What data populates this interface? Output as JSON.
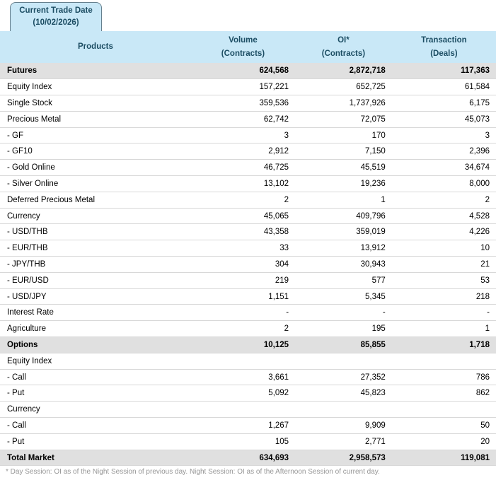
{
  "tab": {
    "label_line1": "Current Trade Date",
    "label_line2": "(10/02/2026)"
  },
  "table": {
    "columns": [
      {
        "label": "Products",
        "sub": ""
      },
      {
        "label": "Volume",
        "sub": "(Contracts)"
      },
      {
        "label": "OI*",
        "sub": "(Contracts)"
      },
      {
        "label": "Transaction",
        "sub": "(Deals)"
      }
    ],
    "rows": [
      {
        "product": "Futures",
        "type": "section",
        "volume": "624,568",
        "oi": "2,872,718",
        "deals": "117,363"
      },
      {
        "product": "Equity Index",
        "type": "normal",
        "volume": "157,221",
        "oi": "652,725",
        "deals": "61,584"
      },
      {
        "product": "Single Stock",
        "type": "normal",
        "volume": "359,536",
        "oi": "1,737,926",
        "deals": "6,175"
      },
      {
        "product": "Precious Metal",
        "type": "normal",
        "volume": "62,742",
        "oi": "72,075",
        "deals": "45,073"
      },
      {
        "product": "- GF",
        "type": "normal",
        "volume": "3",
        "oi": "170",
        "deals": "3"
      },
      {
        "product": "- GF10",
        "type": "normal",
        "volume": "2,912",
        "oi": "7,150",
        "deals": "2,396"
      },
      {
        "product": "- Gold Online",
        "type": "normal",
        "volume": "46,725",
        "oi": "45,519",
        "deals": "34,674"
      },
      {
        "product": "- Silver Online",
        "type": "normal",
        "volume": "13,102",
        "oi": "19,236",
        "deals": "8,000"
      },
      {
        "product": "Deferred Precious Metal",
        "type": "normal",
        "volume": "2",
        "oi": "1",
        "deals": "2"
      },
      {
        "product": "Currency",
        "type": "normal",
        "volume": "45,065",
        "oi": "409,796",
        "deals": "4,528"
      },
      {
        "product": "- USD/THB",
        "type": "normal",
        "volume": "43,358",
        "oi": "359,019",
        "deals": "4,226"
      },
      {
        "product": "- EUR/THB",
        "type": "normal",
        "volume": "33",
        "oi": "13,912",
        "deals": "10"
      },
      {
        "product": "- JPY/THB",
        "type": "normal",
        "volume": "304",
        "oi": "30,943",
        "deals": "21"
      },
      {
        "product": "- EUR/USD",
        "type": "normal",
        "volume": "219",
        "oi": "577",
        "deals": "53"
      },
      {
        "product": "- USD/JPY",
        "type": "normal",
        "volume": "1,151",
        "oi": "5,345",
        "deals": "218"
      },
      {
        "product": "Interest Rate",
        "type": "normal",
        "volume": "-",
        "oi": "-",
        "deals": "-"
      },
      {
        "product": "Agriculture",
        "type": "normal",
        "volume": "2",
        "oi": "195",
        "deals": "1"
      },
      {
        "product": "Options",
        "type": "section",
        "volume": "10,125",
        "oi": "85,855",
        "deals": "1,718"
      },
      {
        "product": "Equity Index",
        "type": "subheader",
        "volume": "",
        "oi": "",
        "deals": ""
      },
      {
        "product": "- Call",
        "type": "normal",
        "volume": "3,661",
        "oi": "27,352",
        "deals": "786"
      },
      {
        "product": "- Put",
        "type": "normal",
        "volume": "5,092",
        "oi": "45,823",
        "deals": "862"
      },
      {
        "product": "Currency",
        "type": "subheader",
        "volume": "",
        "oi": "",
        "deals": ""
      },
      {
        "product": "- Call",
        "type": "normal",
        "volume": "1,267",
        "oi": "9,909",
        "deals": "50"
      },
      {
        "product": "- Put",
        "type": "normal",
        "volume": "105",
        "oi": "2,771",
        "deals": "20"
      },
      {
        "product": "Total Market",
        "type": "total",
        "volume": "634,693",
        "oi": "2,958,573",
        "deals": "119,081"
      }
    ]
  },
  "footnote": "* Day Session: OI as of the Night Session of previous day. Night Session: OI as of the Afternoon Session of current day.",
  "colors": {
    "header_bg": "#c9e8f7",
    "header_text": "#1c4d63",
    "section_bg": "#e0e0e0",
    "row_border": "#d8d8d8",
    "tab_border": "#66808e",
    "footnote_text": "#969696"
  }
}
